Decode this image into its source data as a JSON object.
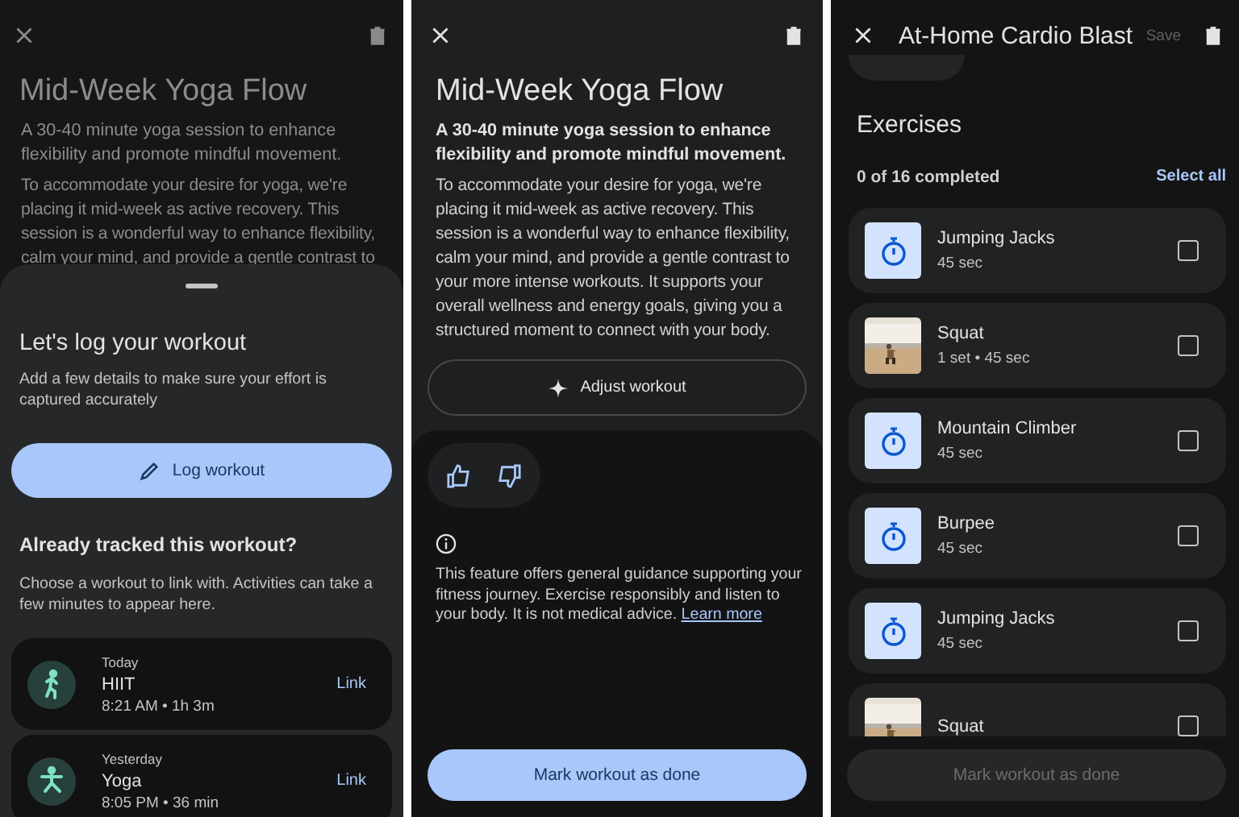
{
  "log_screen": {
    "title": "Mid-Week Yoga Flow",
    "summary": "A 30-40 minute yoga session to enhance flexibility and promote mindful movement.",
    "description": "To accommodate your desire for yoga, we're placing it mid-week as active recovery. This session is a wonderful way to enhance flexibility, calm your mind, and provide a gentle contrast to",
    "sheet": {
      "title": "Let's log your workout",
      "description": "Add a few details to make sure your effort is captured accurately",
      "log_button": "Log workout",
      "linked_heading": "Already tracked this workout?",
      "linked_description": "Choose a workout to link with. Activities can take a few minutes to appear here.",
      "workouts": [
        {
          "kind": "running",
          "day": "Today",
          "name": "HIIT",
          "details": "8:21 AM • 1h 3m",
          "link": "Link"
        },
        {
          "kind": "yoga",
          "day": "Yesterday",
          "name": "Yoga",
          "details": "8:05 PM • 36 min",
          "link": "Link"
        }
      ]
    }
  },
  "detail_screen": {
    "title": "Mid-Week Yoga Flow",
    "summary": "A 30-40 minute yoga session to enhance flexibility and promote mindful movement.",
    "description": "To accommodate your desire for yoga, we're placing it mid-week as active recovery. This session is a wonderful way to enhance flexibility, calm your mind, and provide a gentle contrast to your more intense workouts. It supports your overall wellness and energy goals, giving you a structured moment to connect with your body.",
    "adjust_button": "Adjust workout",
    "disclaimer": {
      "text": "This feature offers general guidance supporting your fitness journey. Exercise responsibly and listen to your body. It is not medical advice.",
      "link": "Learn more"
    },
    "done_button": {
      "label": "Mark workout as done",
      "disabled": false
    }
  },
  "exercise_screen": {
    "title": "At-Home Cardio Blast",
    "save": {
      "label": "Save",
      "disabled": true
    },
    "section_title": "Exercises",
    "progress": "0 of 16 completed",
    "select_all": "Select all",
    "exercises": [
      {
        "kind": "timer",
        "name": "Jumping Jacks",
        "detail": "45 sec",
        "checked": false
      },
      {
        "kind": "picture",
        "name": "Squat",
        "detail": "1 set • 45 sec",
        "checked": false
      },
      {
        "kind": "timer",
        "name": "Mountain Climber",
        "detail": "45 sec",
        "checked": false
      },
      {
        "kind": "timer",
        "name": "Burpee",
        "detail": "45 sec",
        "checked": false
      },
      {
        "kind": "timer",
        "name": "Jumping Jacks",
        "detail": "45 sec",
        "checked": false
      },
      {
        "kind": "picture",
        "name": "Squat",
        "checked": false
      }
    ],
    "done_button": {
      "label": "Mark workout as done",
      "disabled": true
    }
  }
}
